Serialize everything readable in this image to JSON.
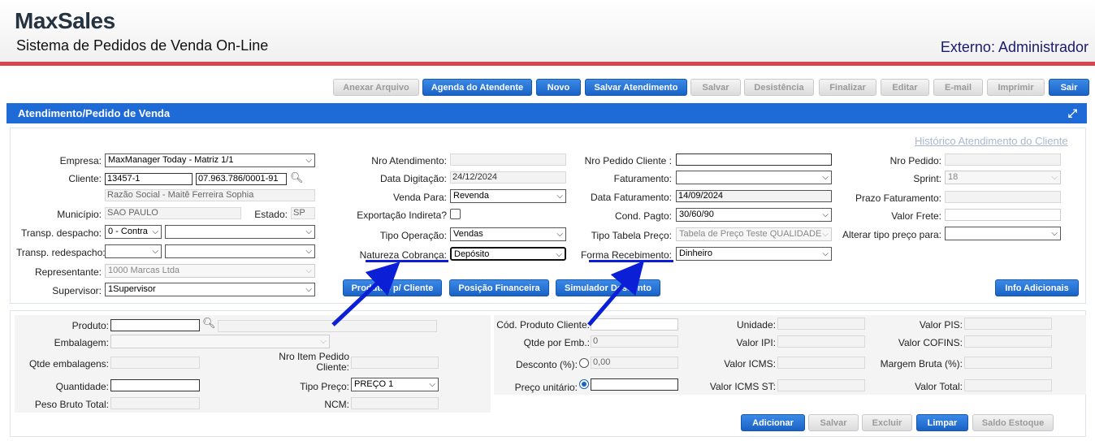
{
  "header": {
    "logo": "MaxSales",
    "subtitle": "Sistema de Pedidos de Venda On-Line",
    "user": "Externo: Administrador"
  },
  "toolbar": {
    "anexar": "Anexar Arquivo",
    "agenda": "Agenda do Atendente",
    "novo": "Novo",
    "salvar_atendimento": "Salvar Atendimento",
    "salvar": "Salvar",
    "desistencia": "Desistência",
    "finalizar": "Finalizar",
    "editar": "Editar",
    "email": "E-mail",
    "imprimir": "Imprimir",
    "sair": "Sair"
  },
  "panel": {
    "title": "Atendimento/Pedido de Venda",
    "historico_link": "Histórico Atendimento do Cliente"
  },
  "form": {
    "empresa_label": "Empresa:",
    "empresa_value": "MaxManager Today - Matriz 1/1",
    "cliente_label": "Cliente:",
    "cliente_code": "13457-1",
    "cliente_cnpj": "07.963.786/0001-91",
    "razao_social": "Razão Social - Maitê Ferreira Sophia",
    "municipio_label": "Município:",
    "municipio_value": "SAO PAULO",
    "estado_label": "Estado:",
    "estado_value": "SP",
    "transp_despacho_label": "Transp. despacho:",
    "transp_despacho_value": "0 - Contra",
    "transp_redespacho_label": "Transp. redespacho:",
    "representante_label": "Representante:",
    "representante_value": "1000 Marcas Ltda",
    "supervisor_label": "Supervisor:",
    "supervisor_value": "1Supervisor",
    "nro_atendimento_label": "Nro Atendimento:",
    "data_digitacao_label": "Data Digitação:",
    "data_digitacao_value": "24/12/2024",
    "venda_para_label": "Venda Para:",
    "venda_para_value": "Revenda",
    "exportacao_label": "Exportação Indireta?",
    "tipo_operacao_label": "Tipo Operação:",
    "tipo_operacao_value": "Vendas",
    "natureza_label": "Natureza Cobrança:",
    "natureza_value": "Depósito",
    "nro_pedido_cliente_label": "Nro Pedido Cliente :",
    "faturamento_label": "Faturamento:",
    "data_faturamento_label": "Data Faturamento:",
    "data_faturamento_value": "14/09/2024",
    "cond_pagto_label": "Cond. Pagto:",
    "cond_pagto_value": "30/60/90",
    "tipo_tabela_label": "Tipo Tabela Preço:",
    "tipo_tabela_value": "Tabela de Preço Teste QUALIDADE",
    "forma_recebimento_label": "Forma Recebimento:",
    "forma_recebimento_value": "Dinheiro",
    "nro_pedido_label": "Nro Pedido:",
    "sprint_label": "Sprint:",
    "sprint_value": "18",
    "prazo_label": "Prazo Faturamento:",
    "valor_frete_label": "Valor Frete:",
    "alterar_tipo_label": "Alterar tipo preço para:",
    "btn_produtos": "Produtos p/ Cliente",
    "btn_posicao": "Posição Financeira",
    "btn_simulador": "Simulador Desconto",
    "btn_info": "Info Adicionais"
  },
  "produto": {
    "produto_label": "Produto:",
    "embalagem_label": "Embalagem:",
    "qtde_embalagens_label": "Qtde embalagens:",
    "quantidade_label": "Quantidade:",
    "peso_label": "Peso Bruto Total:",
    "nro_item_label": "Nro Item Pedido Cliente:",
    "tipo_preco_label": "Tipo Preço:",
    "tipo_preco_value": "PREÇO 1",
    "ncm_label": "NCM:",
    "cod_produto_label": "Cód. Produto Cliente:",
    "qtde_emb_label": "Qtde por Emb.:",
    "qtde_emb_value": "0",
    "desconto_label": "Desconto (%):",
    "desconto_value": "0,00",
    "preco_label": "Preço unitário:",
    "unidade_label": "Unidade:",
    "ipi_label": "Valor IPI:",
    "icms_label": "Valor ICMS:",
    "icms_st_label": "Valor ICMS ST:",
    "pis_label": "Valor PIS:",
    "cofins_label": "Valor COFINS:",
    "margem_label": "Margem Bruta (%):",
    "total_label": "Valor Total:",
    "btn_adicionar": "Adicionar",
    "btn_salvar": "Salvar",
    "btn_excluir": "Excluir",
    "btn_limpar": "Limpar",
    "btn_saldo": "Saldo Estoque"
  },
  "colors": {
    "accent": "#1e6ad6",
    "brand_red": "#d9434b",
    "annotation": "#0a1fd6"
  }
}
